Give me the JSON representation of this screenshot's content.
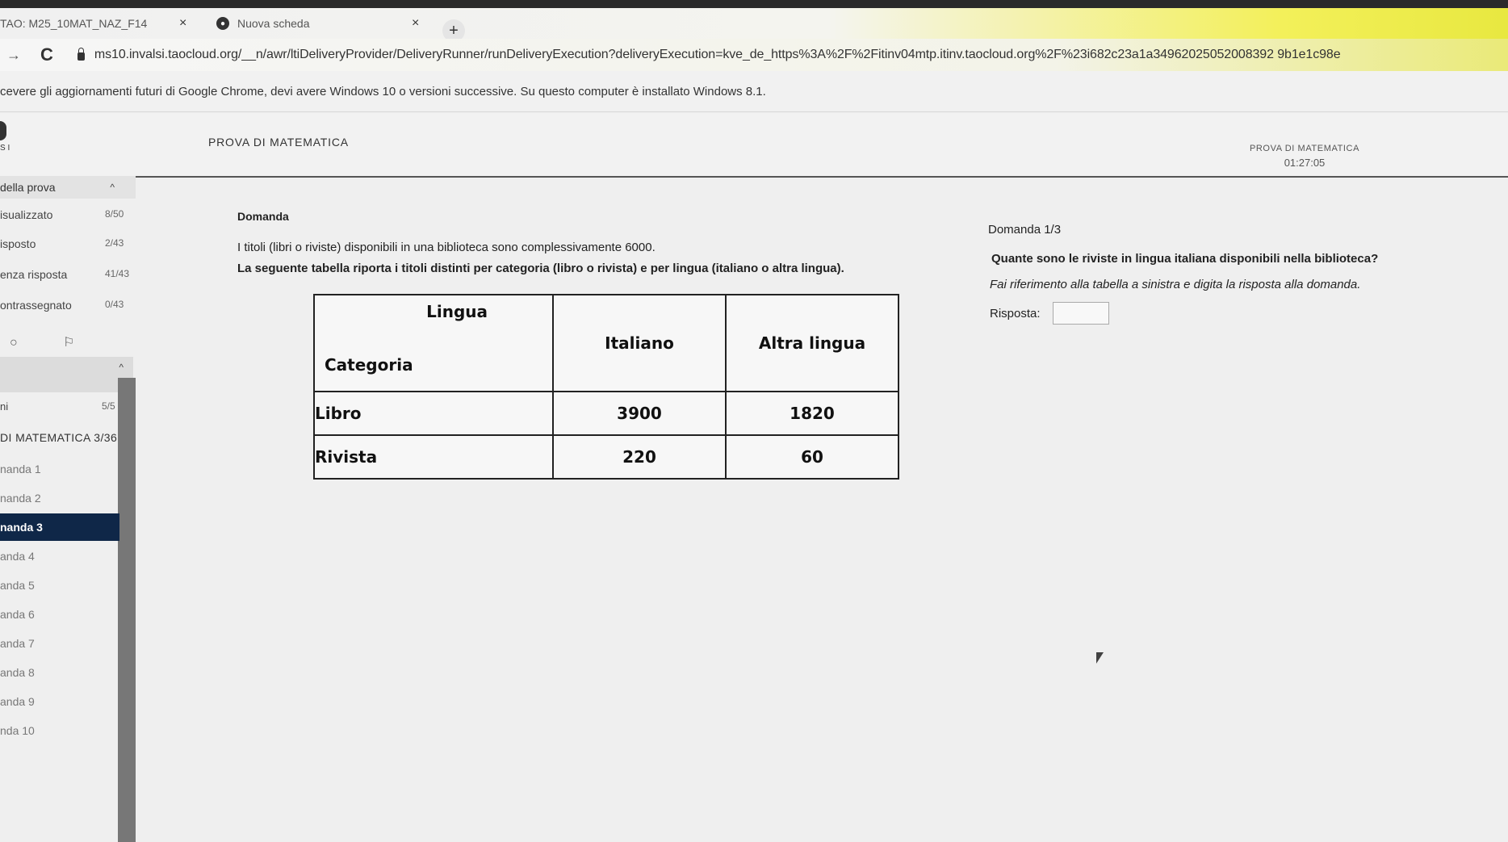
{
  "browser": {
    "tabs": [
      {
        "title": "TAO: M25_10MAT_NAZ_F14",
        "close": "×"
      },
      {
        "title": "Nuova scheda",
        "close": "×"
      }
    ],
    "new_tab": "+",
    "nav_back": "→",
    "nav_reload": "C",
    "url": "ms10.invalsi.taocloud.org/__n/awr/ltiDeliveryProvider/DeliveryRunner/runDeliveryExecution?deliveryExecution=kve_de_https%3A%2F%2Fitinv04mtp.itinv.taocloud.org%2F%23i682c23a1a34962025052008392 9b1e1c98e",
    "infobar": "cevere gli aggiornamenti futuri di Google Chrome, devi avere Windows 10 o versioni successive. Su questo computer è installato Windows 8.1."
  },
  "header": {
    "logo_sub": "S I",
    "title": "PROVA DI MATEMATICA",
    "right_title": "PROVA DI MATEMATICA",
    "timer": "01:27:05"
  },
  "sidebar": {
    "overview_title": "della prova",
    "chevron_up": "^",
    "stats": [
      {
        "label": "isualizzato",
        "value": "8/50"
      },
      {
        "label": "isposto",
        "value": "2/43"
      },
      {
        "label": "enza risposta",
        "value": "41/43"
      },
      {
        "label": "ontrassegnato",
        "value": "0/43"
      }
    ],
    "filter_icons": [
      "○",
      "⚐"
    ],
    "part": {
      "label": "ni",
      "value": "5/5"
    },
    "section": "DI MATEMATICA 3/36",
    "items": [
      "nanda 1",
      "nanda 2",
      "nanda 3",
      "anda 4",
      "anda 5",
      "anda 6",
      "anda 7",
      "anda 8",
      "anda 9",
      "nda 10"
    ],
    "active_index": 2
  },
  "main": {
    "label": "Domanda",
    "text1": "I titoli (libri o riviste) disponibili in una biblioteca sono complessivamente 6000.",
    "text2": "La seguente tabella riporta i titoli distinti per categoria (libro o rivista) e per lingua (italiano o altra lingua).",
    "table": {
      "corner_top": "Lingua",
      "corner_bottom": "Categoria",
      "columns": [
        "Italiano",
        "Altra lingua"
      ],
      "rows": [
        {
          "label": "Libro",
          "values": [
            "3900",
            "1820"
          ]
        },
        {
          "label": "Rivista",
          "values": [
            "220",
            "60"
          ]
        }
      ]
    }
  },
  "right_panel": {
    "count": "Domanda 1/3",
    "question": "Quante sono le riviste in lingua italiana disponibili nella biblioteca?",
    "instruction": "Fai riferimento alla tabella a sinistra e digita la risposta alla domanda.",
    "answer_label": "Risposta:",
    "answer_value": ""
  }
}
